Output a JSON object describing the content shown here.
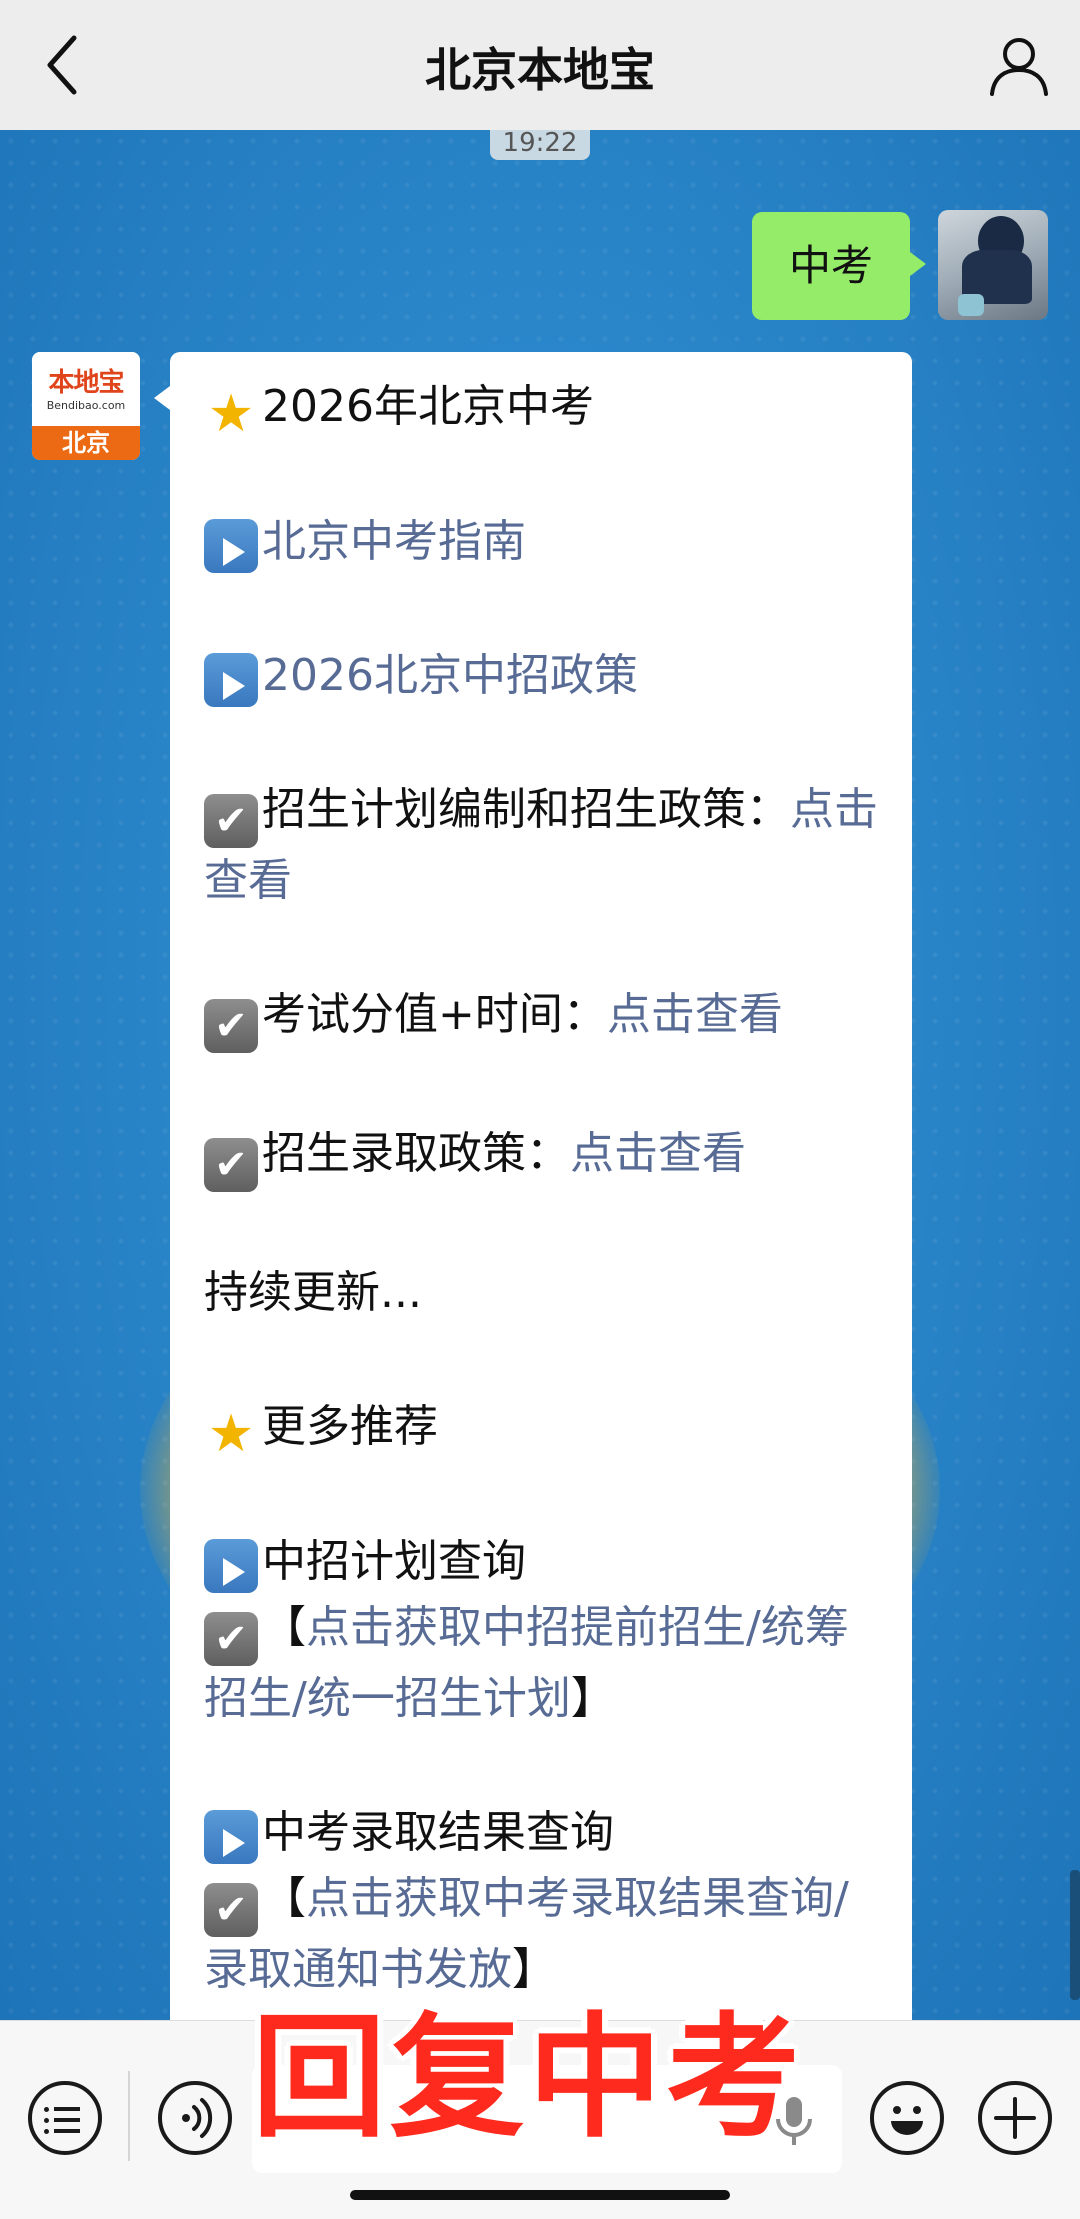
{
  "header": {
    "title": "北京本地宝",
    "back_icon": "chevron-left-icon",
    "profile_icon": "user-icon"
  },
  "chat": {
    "time_label": "19:22",
    "sent_message": "中考",
    "bot_avatar": {
      "logo_text": "本地宝",
      "domain": "Bendibao.com",
      "city": "北京"
    },
    "reply": {
      "title": "2026年北京中考",
      "items": [
        {
          "prefix": "",
          "label": "北京中考指南"
        },
        {
          "prefix": "",
          "label": "2026北京中招政策"
        }
      ],
      "checks": [
        {
          "label": "招生计划编制和招生政策：",
          "link": "点击查看"
        },
        {
          "label": "考试分值+时间：",
          "link": "点击查看"
        },
        {
          "label": "招生录取政策：",
          "link": "点击查看"
        }
      ],
      "continuing": "持续更新...",
      "more_title": "更多推荐",
      "more": [
        {
          "label": "中招计划查询",
          "bracket_open": "【",
          "link": "点击获取中招提前招生/统筹招生/统一招生计划",
          "bracket_close": "】"
        },
        {
          "label": "中考录取结果查询",
          "bracket_open": "【",
          "link": "点击获取中考录取结果查询/录取通知书发放",
          "bracket_close": "】"
        }
      ]
    }
  },
  "bottom_bar": {
    "menu_icon": "menu-list-icon",
    "voice_icon": "voice-icon",
    "mic_icon": "mic-icon",
    "emoji_icon": "emoji-icon",
    "plus_icon": "plus-icon",
    "overlay_text": "回复中考"
  },
  "colors": {
    "link": "#576b95",
    "sent_bubble": "#95ec69",
    "overlay": "#ff2a1e",
    "background": "#2a86c9"
  }
}
